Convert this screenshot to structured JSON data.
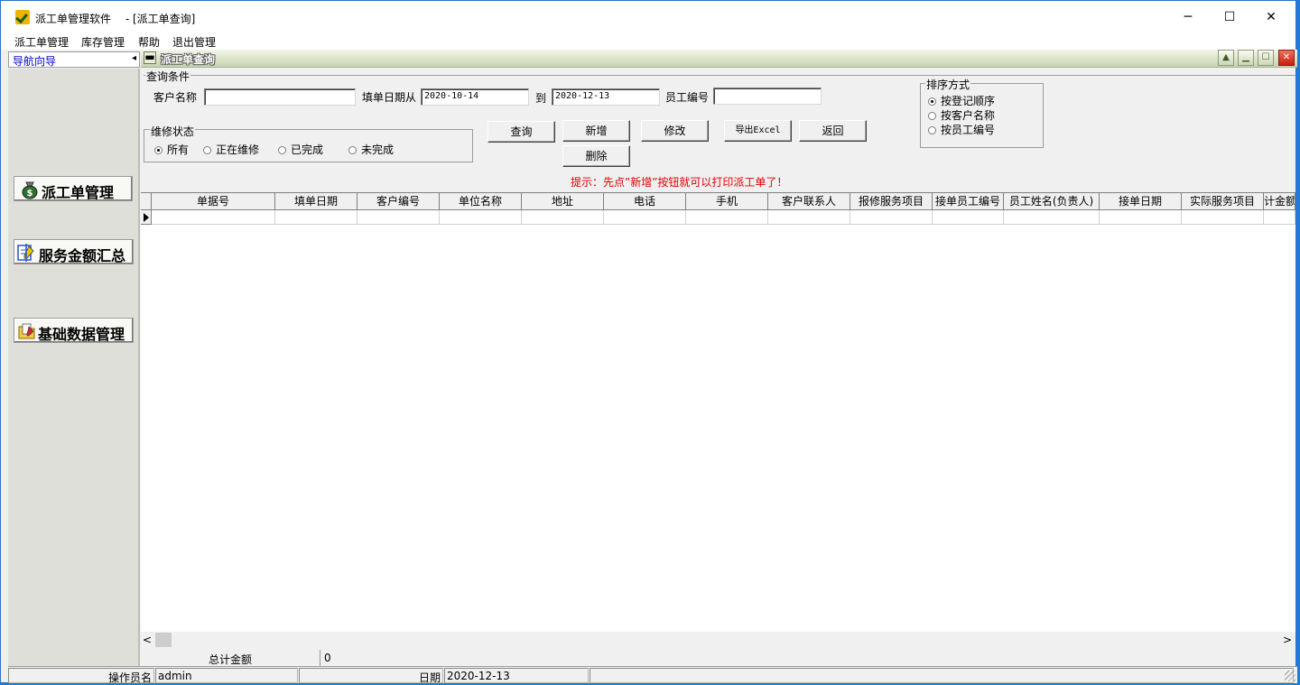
{
  "window": {
    "title": "派工单管理软件　 - [派工单查询]",
    "controls": {
      "minimize": "─",
      "maximize": "☐",
      "close": "✕"
    }
  },
  "menu": [
    "派工单管理",
    "库存管理",
    "帮助",
    "退出管理"
  ],
  "nav": {
    "title": "导航向导",
    "collapse": "◂",
    "buttons": [
      {
        "label": "派工单管理",
        "icon": "money-bag-icon"
      },
      {
        "label": "服务金额汇总",
        "icon": "document-edit-icon"
      },
      {
        "label": "基础数据管理",
        "icon": "folder-edit-icon"
      }
    ]
  },
  "child_window": {
    "title": "派工单查询",
    "icon": "▬",
    "controls": {
      "up": "▲",
      "minimize": "▁",
      "maximize": "☐",
      "close": "✕"
    }
  },
  "query": {
    "group_title": "查询条件",
    "customer_label": "客户名称",
    "customer_value": "",
    "date_from_label": "填单日期从",
    "date_from": "2020-10-14",
    "date_to_label": "到",
    "date_to": "2020-12-13",
    "employee_label": "员工编号",
    "employee_value": ""
  },
  "repair_status": {
    "title": "维修状态",
    "options": [
      "所有",
      "正在维修",
      "已完成",
      "未完成"
    ],
    "selected": 0
  },
  "buttons": {
    "query": "查询",
    "add": "新增",
    "edit": "修改",
    "export": "导出Excel",
    "back": "返回",
    "delete": "删除"
  },
  "hint": "提示：先点”新增”按钮就可以打印派工单了！",
  "sort": {
    "title": "排序方式",
    "options": [
      "按登记顺序",
      "按客户名称",
      "按员工编号"
    ],
    "selected": 0
  },
  "grid": {
    "columns": [
      "单据号",
      "填单日期",
      "客户编号",
      "单位名称",
      "地址",
      "电话",
      "手机",
      "客户联系人",
      "报修服务项目",
      "接单员工编号",
      "员工姓名(负责人)",
      "接单日期",
      "实际服务项目",
      "计金额"
    ]
  },
  "scroll": {
    "left": "<",
    "right": ">"
  },
  "totals": {
    "label": "总计金额",
    "value": "0"
  },
  "status": {
    "operator_label": "操作员名",
    "operator": "admin",
    "date_label": "日期",
    "date": "2020-12-13"
  }
}
